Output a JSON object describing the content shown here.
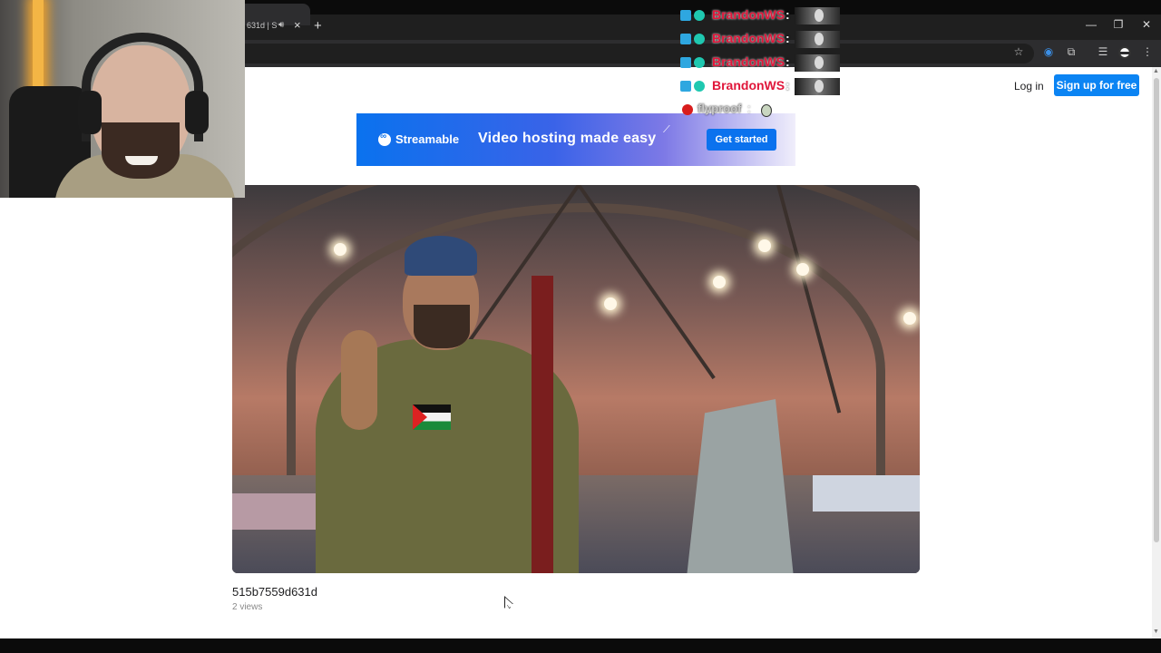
{
  "browser": {
    "tab_title": "631d | St",
    "tab_audio_icon": "speaker-icon",
    "tab_close_icon": "×",
    "new_tab_icon": "+",
    "window_minimize": "—",
    "window_restore": "❐",
    "window_close": "✕",
    "toolbar_icons": [
      "star-icon",
      "voice-extension-icon",
      "extensions-icon",
      "reading-list-icon",
      "profile-avatar-icon",
      "more-menu-icon"
    ]
  },
  "header": {
    "login_label": "Log in",
    "signup_label": "Sign up for free"
  },
  "ad": {
    "brand": "Streamable",
    "tagline": "Video hosting made easy",
    "cta": "Get started",
    "colors": [
      "#0a72ee",
      "#7d79e6"
    ]
  },
  "video": {
    "title": "515b7559d631d",
    "views": "2 views"
  },
  "chat": {
    "messages": [
      {
        "user": "BrandonWS",
        "separator": ":",
        "emote": "photo-emote"
      },
      {
        "user": "BrandonWS",
        "separator": ":",
        "emote": "photo-emote"
      },
      {
        "user": "BrandonWS",
        "separator": ":",
        "emote": "photo-emote"
      },
      {
        "user": "BrandonWS",
        "separator": ":",
        "emote": "photo-emote"
      },
      {
        "user": "flyproof",
        "separator": ":",
        "emote": "alien-emote"
      }
    ],
    "name_color": "#e0163a"
  },
  "accent_color": "#0b84f3"
}
